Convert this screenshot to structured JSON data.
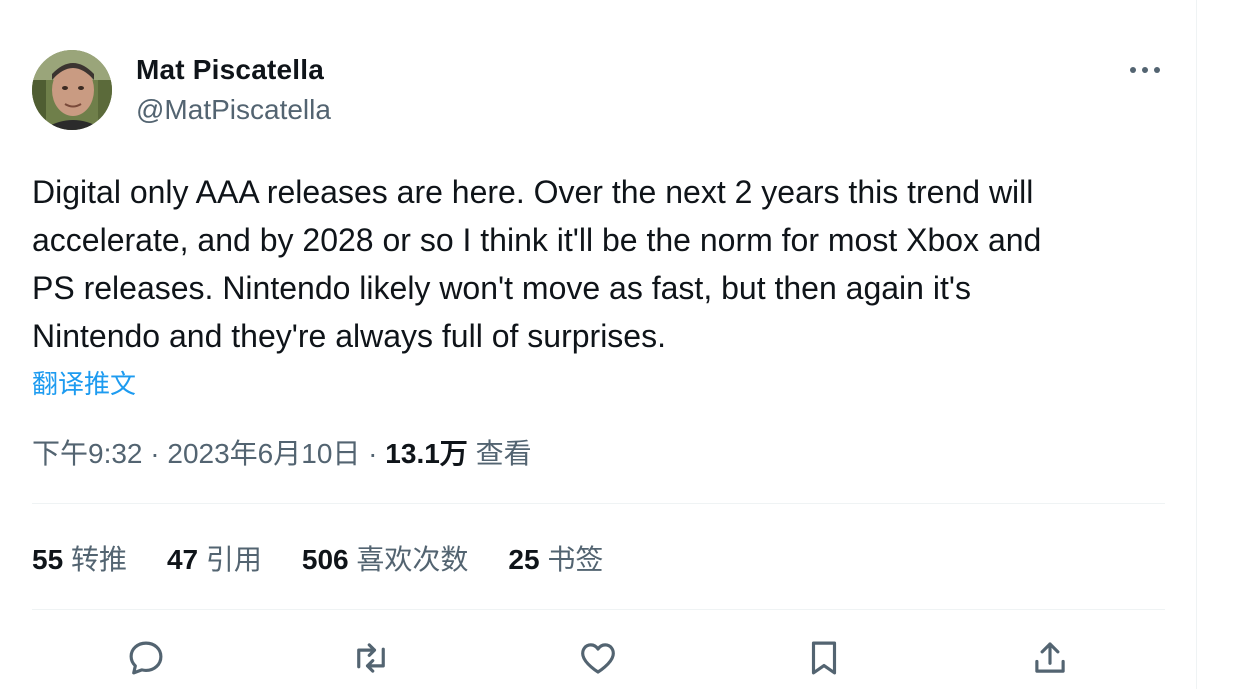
{
  "author": {
    "display_name": "Mat Piscatella",
    "handle": "@MatPiscatella"
  },
  "tweet": {
    "text_lines": [
      "Digital only AAA releases are here. Over the next 2 years this trend will",
      "accelerate, and by 2028 or so I think it'll be the norm for most Xbox and",
      "PS releases. Nintendo likely won't move as fast, but then again it's",
      "Nintendo and they're always full of surprises."
    ],
    "translate_label": "翻译推文"
  },
  "meta": {
    "time": "下午9:32",
    "sep1": " · ",
    "date": "2023年6月10日",
    "sep2": " · ",
    "views_count": "13.1万",
    "views_label": " 查看"
  },
  "stats": {
    "retweets": {
      "count": "55",
      "label": "转推"
    },
    "quotes": {
      "count": "47",
      "label": "引用"
    },
    "likes": {
      "count": "506",
      "label": "喜欢次数"
    },
    "bookmarks": {
      "count": "25",
      "label": "书签"
    }
  },
  "icons": {
    "more": "more-horizontal-icon",
    "reply": "reply-icon",
    "retweet": "retweet-icon",
    "like": "heart-icon",
    "bookmark": "bookmark-icon",
    "share": "share-icon"
  },
  "colors": {
    "text_primary": "#0f1419",
    "text_secondary": "#536471",
    "link": "#1d9bf0",
    "divider": "#eff3f4"
  }
}
